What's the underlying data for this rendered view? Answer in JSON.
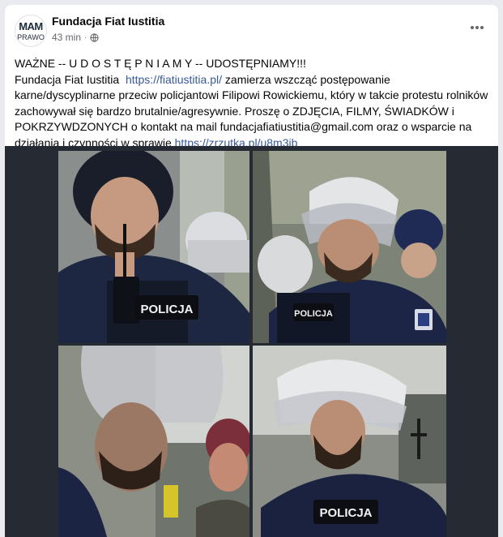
{
  "post": {
    "author": "Fundacja Fiat Iustitia",
    "avatar_text_line1": "MAM",
    "avatar_text_line2": "PRAWO",
    "time": "43 min",
    "meta_separator": "·",
    "more_icon": "more-horizontal-icon",
    "line1": "WAŻNE -- U D O S T Ę P N I A M Y -- UDOSTĘPNIAMY!!!",
    "org_name": "Fundacja Fiat Iustitia",
    "link1": "https://fiatiustitia.pl/",
    "body_part1": " zamierza wszcząć postępowanie karne/dyscyplinarne przeciw policjantowi  Filipowi Rowickiemu, który w takcie protestu rolników zachowywał się bardzo brutalnie/agresywnie. Proszę o ZDJĘCIA, FILMY, ŚWIADKÓW i POKRZYWDZONYCH o kontakt na mail fundacjafiatiustitia@gmail.com oraz o wsparcie na działania i czynności w sprawie ",
    "link2": "https://zrzutka.pl/u8m3jb"
  },
  "photos": {
    "vest_label_1": "POLICJA",
    "vest_label_2": "POLICJA",
    "vest_label_4": "POLICJA"
  },
  "colors": {
    "link": "#385898",
    "text": "#050505",
    "meta": "#65676b",
    "photo_background": "#262b33"
  }
}
